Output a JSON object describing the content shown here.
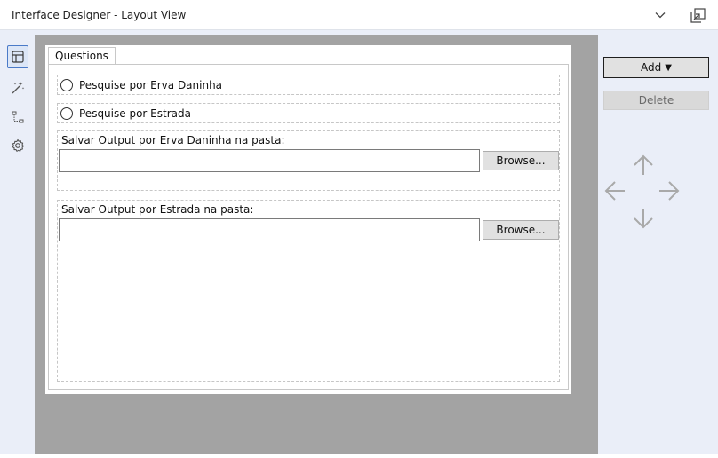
{
  "window": {
    "title": "Interface Designer - Layout View"
  },
  "iconbar": {
    "items": [
      {
        "name": "layout-view-icon",
        "active": true
      },
      {
        "name": "wand-icon",
        "active": false
      },
      {
        "name": "tree-icon",
        "active": false
      },
      {
        "name": "gear-icon",
        "active": false
      }
    ]
  },
  "form": {
    "tab_label": "Questions",
    "radio_weed": "Pesquise por Erva Daninha",
    "radio_road": "Pesquise por Estrada",
    "weed_folder_label": "Salvar Output por Erva Daninha na pasta:",
    "weed_folder_value": "",
    "road_folder_label": "Salvar Output por Estrada na pasta:",
    "road_folder_value": "",
    "browse_label": "Browse..."
  },
  "rpanel": {
    "add_label": "Add",
    "add_arrow": "▼",
    "delete_label": "Delete"
  },
  "colors": {
    "canvas": "#a3a3a3",
    "panel": "#eaeef8",
    "active_border": "#4a7ac8",
    "arrow": "#a9a9a9"
  }
}
